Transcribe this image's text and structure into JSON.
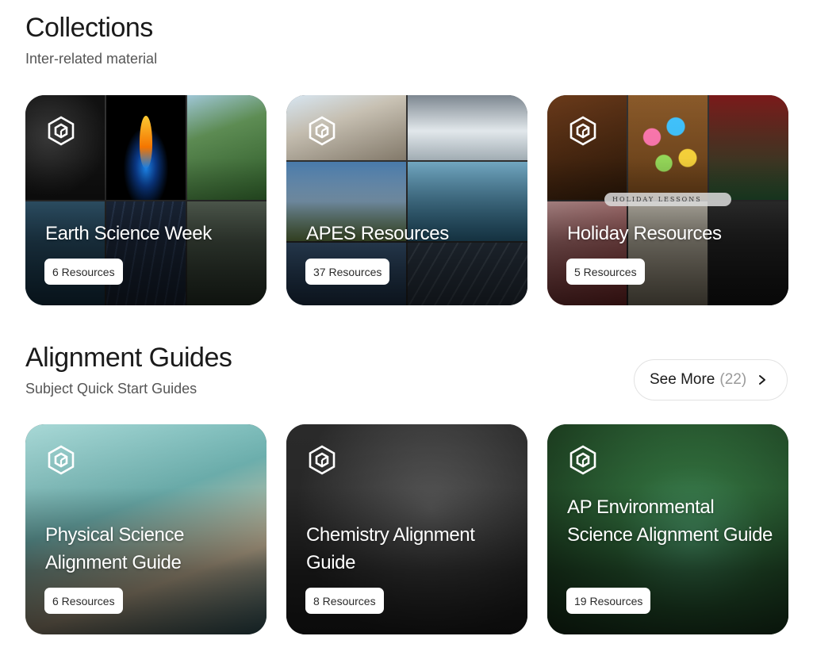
{
  "collections": {
    "title": "Collections",
    "subtitle": "Inter-related material",
    "cards": [
      {
        "title": "Earth Science Week",
        "count": "6 Resources"
      },
      {
        "title": "APES Resources",
        "count": "37 Resources"
      },
      {
        "title": "Holiday Resources",
        "count": "5 Resources",
        "banner": "HOLIDAY LESSONS"
      }
    ]
  },
  "guides": {
    "title": "Alignment Guides",
    "subtitle": "Subject Quick Start Guides",
    "see_more_label": "See More",
    "see_more_count": "(22)",
    "cards": [
      {
        "title": "Physical Science Alignment Guide",
        "count": "6 Resources"
      },
      {
        "title": "Chemistry Alignment Guide",
        "count": "8 Resources"
      },
      {
        "title": "AP Environmental Science Alignment Guide",
        "count": "19 Resources"
      }
    ]
  },
  "icons": {
    "card_logo": "hexagon-cube-logo-icon",
    "see_more_arrow": "chevron-right-icon"
  }
}
